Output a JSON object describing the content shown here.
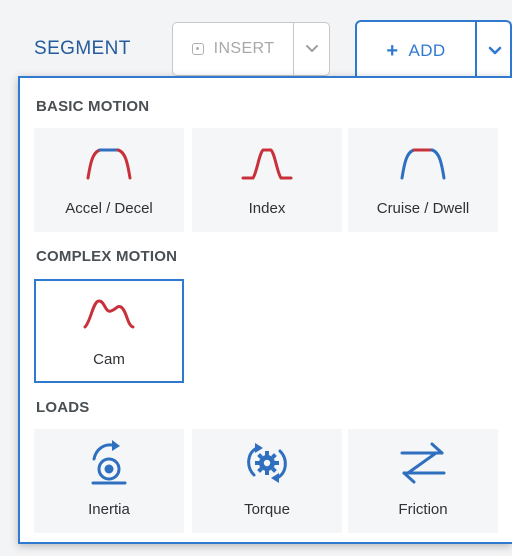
{
  "header": {
    "segment_label": "SEGMENT",
    "insert_label": "INSERT",
    "add_label": "ADD",
    "add_symbol": "+"
  },
  "sections": [
    {
      "title": "BASIC MOTION",
      "items": [
        {
          "label": "Accel / Decel",
          "icon": "accel-decel-icon"
        },
        {
          "label": "Index",
          "icon": "index-icon"
        },
        {
          "label": "Cruise / Dwell",
          "icon": "cruise-dwell-icon"
        }
      ]
    },
    {
      "title": "COMPLEX MOTION",
      "items": [
        {
          "label": "Cam",
          "icon": "cam-icon",
          "selected": true
        }
      ]
    },
    {
      "title": "LOADS",
      "items": [
        {
          "label": "Inertia",
          "icon": "inertia-icon"
        },
        {
          "label": "Torque",
          "icon": "torque-icon"
        },
        {
          "label": "Friction",
          "icon": "friction-icon"
        }
      ]
    }
  ],
  "colors": {
    "accent_blue": "#2f7ad0",
    "motion_red": "#c8313b",
    "segment_blue": "#255b9d"
  }
}
